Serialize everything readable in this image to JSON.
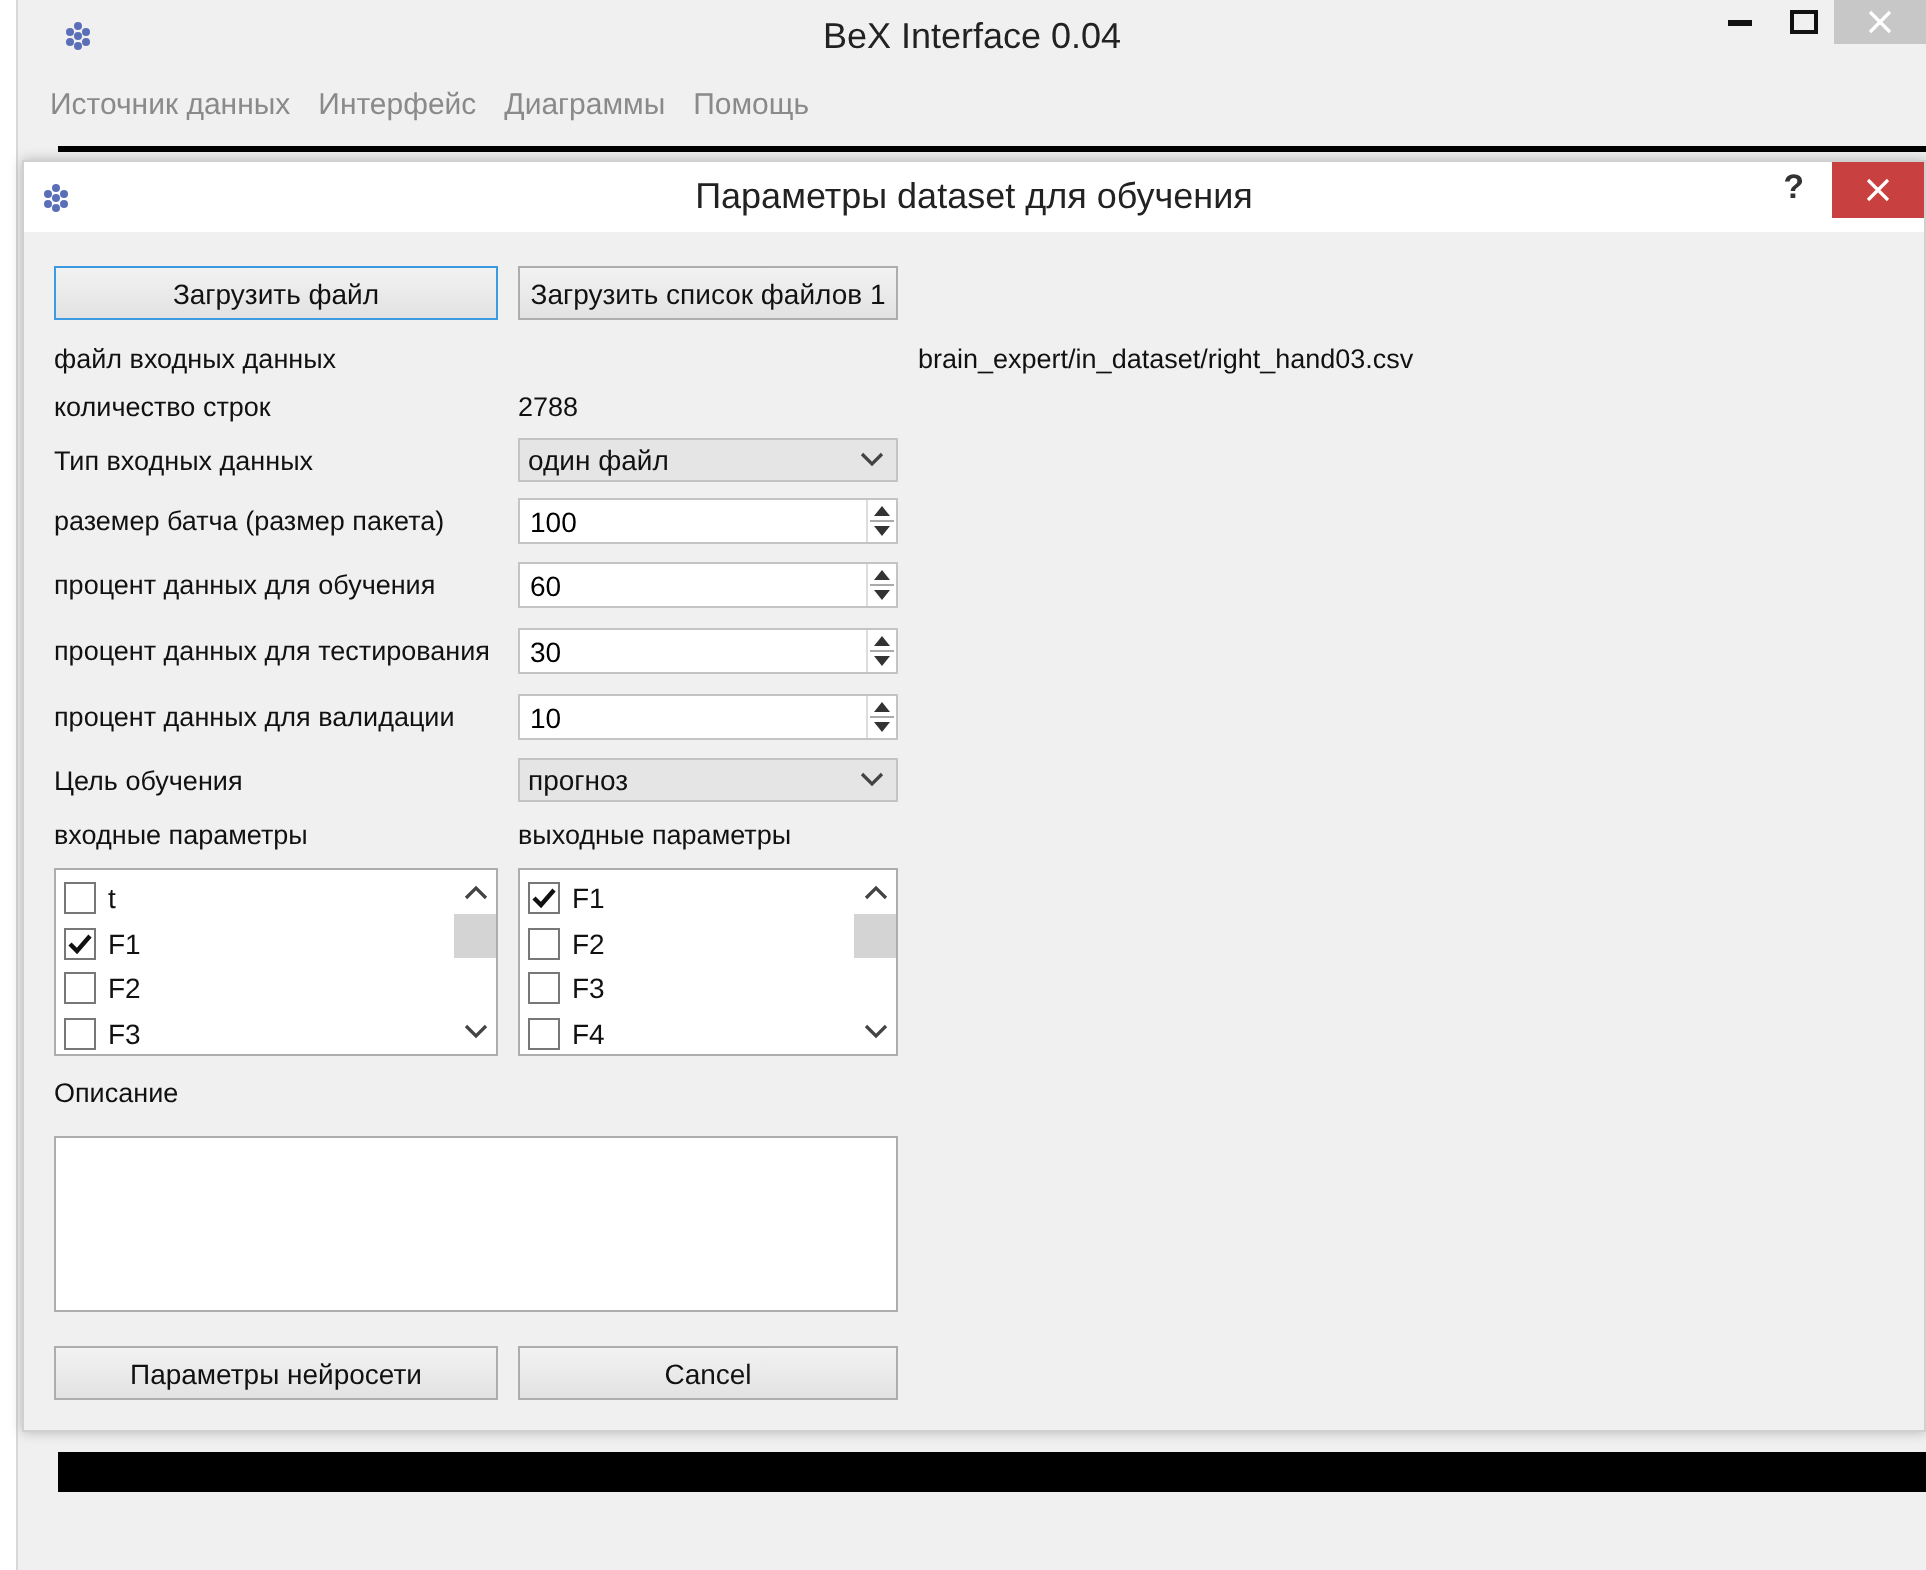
{
  "main_window": {
    "title": "BeX Interface 0.04",
    "menu": [
      "Источник данных",
      "Интерфейс",
      "Диаграммы",
      "Помощь"
    ]
  },
  "dialog": {
    "title": "Параметры dataset для обучения",
    "help": "?",
    "top_buttons": [
      {
        "label": "Загрузить файл",
        "focused": true
      },
      {
        "label": "Загрузить список файлов 1",
        "focused": false
      }
    ],
    "fields": [
      {
        "kind": "file",
        "label": "файл входных данных",
        "value": "brain_expert/in_dataset/right_hand03.csv"
      },
      {
        "kind": "text",
        "label": "количество строк",
        "value": "2788"
      },
      {
        "kind": "combo",
        "label": "Тип входных данных",
        "value": "один файл"
      },
      {
        "kind": "spin",
        "label": "раземер батча (размер пакета)",
        "value": "100"
      },
      {
        "kind": "spin",
        "label": "процент данных для обучения",
        "value": "60"
      },
      {
        "kind": "spin",
        "label": "процент данных для тестирования",
        "value": "30"
      },
      {
        "kind": "spin",
        "label": "процент данных для валидации",
        "value": "10"
      },
      {
        "kind": "combo",
        "label": "Цель обучения",
        "value": "прогноз"
      }
    ],
    "lists": [
      {
        "label": "входные параметры",
        "items": [
          {
            "label": "t",
            "checked": false
          },
          {
            "label": "F1",
            "checked": true
          },
          {
            "label": "F2",
            "checked": false
          },
          {
            "label": "F3",
            "checked": false
          }
        ]
      },
      {
        "label": "выходные параметры",
        "items": [
          {
            "label": "F1",
            "checked": true
          },
          {
            "label": "F2",
            "checked": false
          },
          {
            "label": "F3",
            "checked": false
          },
          {
            "label": "F4",
            "checked": false
          }
        ]
      }
    ],
    "description": {
      "label": "Описание"
    },
    "bottom_buttons": [
      "Параметры нейросети",
      "Cancel"
    ]
  }
}
